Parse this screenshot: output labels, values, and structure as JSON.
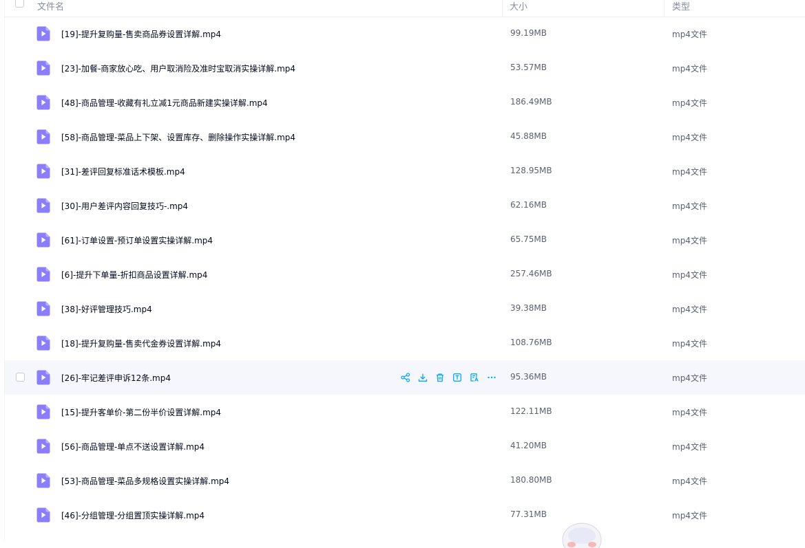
{
  "header": {
    "name_label": "文件名",
    "size_label": "大小",
    "type_label": "类型"
  },
  "colors": {
    "icon_purple": "#8c7dfa",
    "action_blue": "#06a7ff",
    "hover_bg": "#f5f7fc"
  },
  "icons": {
    "file": "video-file-icon",
    "actions": [
      "share-icon",
      "download-icon",
      "delete-icon",
      "rename-icon",
      "translate-icon",
      "more-icon"
    ]
  },
  "files": [
    {
      "name": "[19]-提升复购量-售卖商品券设置详解.mp4",
      "size": "99.19MB",
      "type": "mp4文件"
    },
    {
      "name": "[23]-加餐-商家放心吃、用户取消险及准时宝取消实操详解.mp4",
      "size": "53.57MB",
      "type": "mp4文件"
    },
    {
      "name": "[48]-商品管理-收藏有礼立减1元商品新建实操详解.mp4",
      "size": "186.49MB",
      "type": "mp4文件"
    },
    {
      "name": "[58]-商品管理-菜品上下架、设置库存、删除操作实操详解.mp4",
      "size": "45.88MB",
      "type": "mp4文件"
    },
    {
      "name": "[31]-差评回复标准话术模板.mp4",
      "size": "128.95MB",
      "type": "mp4文件"
    },
    {
      "name": "[30]-用户差评内容回复技巧-.mp4",
      "size": "62.16MB",
      "type": "mp4文件"
    },
    {
      "name": "[61]-订单设置-预订单设置实操详解.mp4",
      "size": "65.75MB",
      "type": "mp4文件"
    },
    {
      "name": "[6]-提升下单量-折扣商品设置详解.mp4",
      "size": "257.46MB",
      "type": "mp4文件"
    },
    {
      "name": "[38]-好评管理技巧.mp4",
      "size": "39.38MB",
      "type": "mp4文件"
    },
    {
      "name": "[18]-提升复购量-售卖代金券设置详解.mp4",
      "size": "108.76MB",
      "type": "mp4文件"
    },
    {
      "name": "[26]-牢记差评申诉12条.mp4",
      "size": "95.36MB",
      "type": "mp4文件",
      "hovered": true
    },
    {
      "name": "[15]-提升客单价-第二份半价设置详解.mp4",
      "size": "122.11MB",
      "type": "mp4文件"
    },
    {
      "name": "[56]-商品管理-单点不送设置详解.mp4",
      "size": "41.20MB",
      "type": "mp4文件"
    },
    {
      "name": "[53]-商品管理-菜品多规格设置实操详解.mp4",
      "size": "180.80MB",
      "type": "mp4文件"
    },
    {
      "name": "[46]-分组管理-分组置顶实操详解.mp4",
      "size": "77.31MB",
      "type": "mp4文件"
    }
  ]
}
